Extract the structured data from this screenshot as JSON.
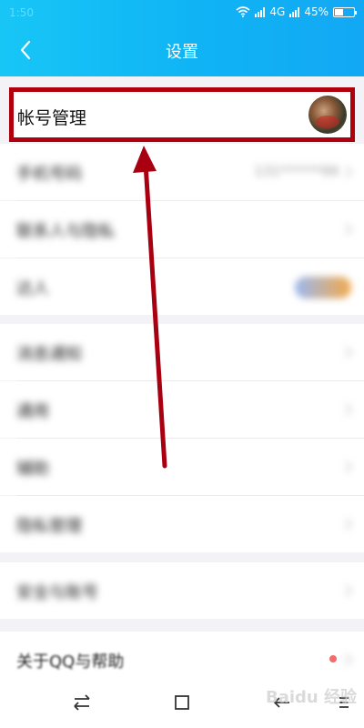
{
  "status_bar": {
    "time": "1:50",
    "network": "4G",
    "battery": "45%",
    "battery_level": 0.45
  },
  "header": {
    "back_label": "返回",
    "title": "设置"
  },
  "account_row": {
    "label": "帐号管理",
    "avatar_name": "avatar"
  },
  "rows": [
    {
      "label": "手机号码",
      "value": "131******99"
    },
    {
      "label": "联系人与隐私",
      "value": ""
    },
    {
      "label": "达人",
      "value": ""
    },
    {
      "label": "消息通知",
      "value": ""
    },
    {
      "label": "通用",
      "value": ""
    },
    {
      "label": "辅助",
      "value": ""
    },
    {
      "label": "隐私管理",
      "value": ""
    },
    {
      "label": "安全与账号",
      "value": ""
    },
    {
      "label": "关于QQ与帮助",
      "value": ""
    }
  ],
  "colors": {
    "header_start": "#18c6f6",
    "header_end": "#12a8f4",
    "highlight": "#b0000e"
  },
  "watermark": "Baidu 经验",
  "icons": {
    "back": "chevron-left-icon",
    "chevron": "chevron-right-icon",
    "wifi": "wifi-icon",
    "signal": "signal-icon",
    "battery": "battery-icon",
    "nav_switch": "switch-icon",
    "nav_home": "home-icon",
    "nav_back": "back-arrow-icon",
    "nav_menu": "menu-icon"
  }
}
